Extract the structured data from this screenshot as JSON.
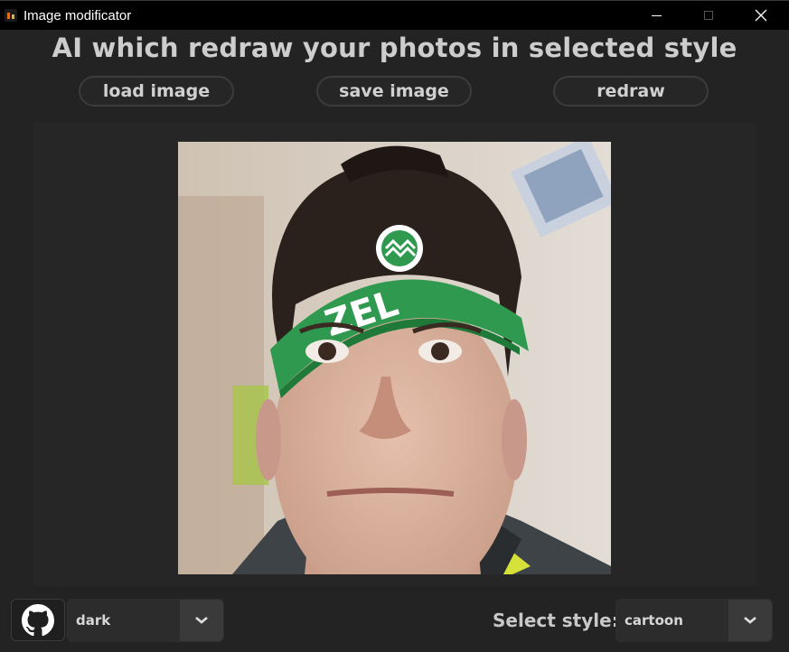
{
  "window": {
    "title": "Image modificator",
    "controls": [
      "minimize-icon",
      "maximize-icon",
      "close-icon"
    ]
  },
  "header": {
    "title": "AI which redraw your photos in selected style"
  },
  "toolbar": {
    "load_label": "load image",
    "save_label": "save image",
    "redraw_label": "redraw"
  },
  "preview": {
    "icon": "photo-portrait"
  },
  "footer": {
    "github_icon": "github-icon",
    "theme_value": "dark",
    "style_label": "Select style:",
    "style_value": "cartoon"
  },
  "colors": {
    "background": "#232323",
    "titlebar": "#000000",
    "text": "#cdcdcd",
    "button_border": "#3c3c3c",
    "dropdown_arrow_bg": "#3a3a3a"
  }
}
